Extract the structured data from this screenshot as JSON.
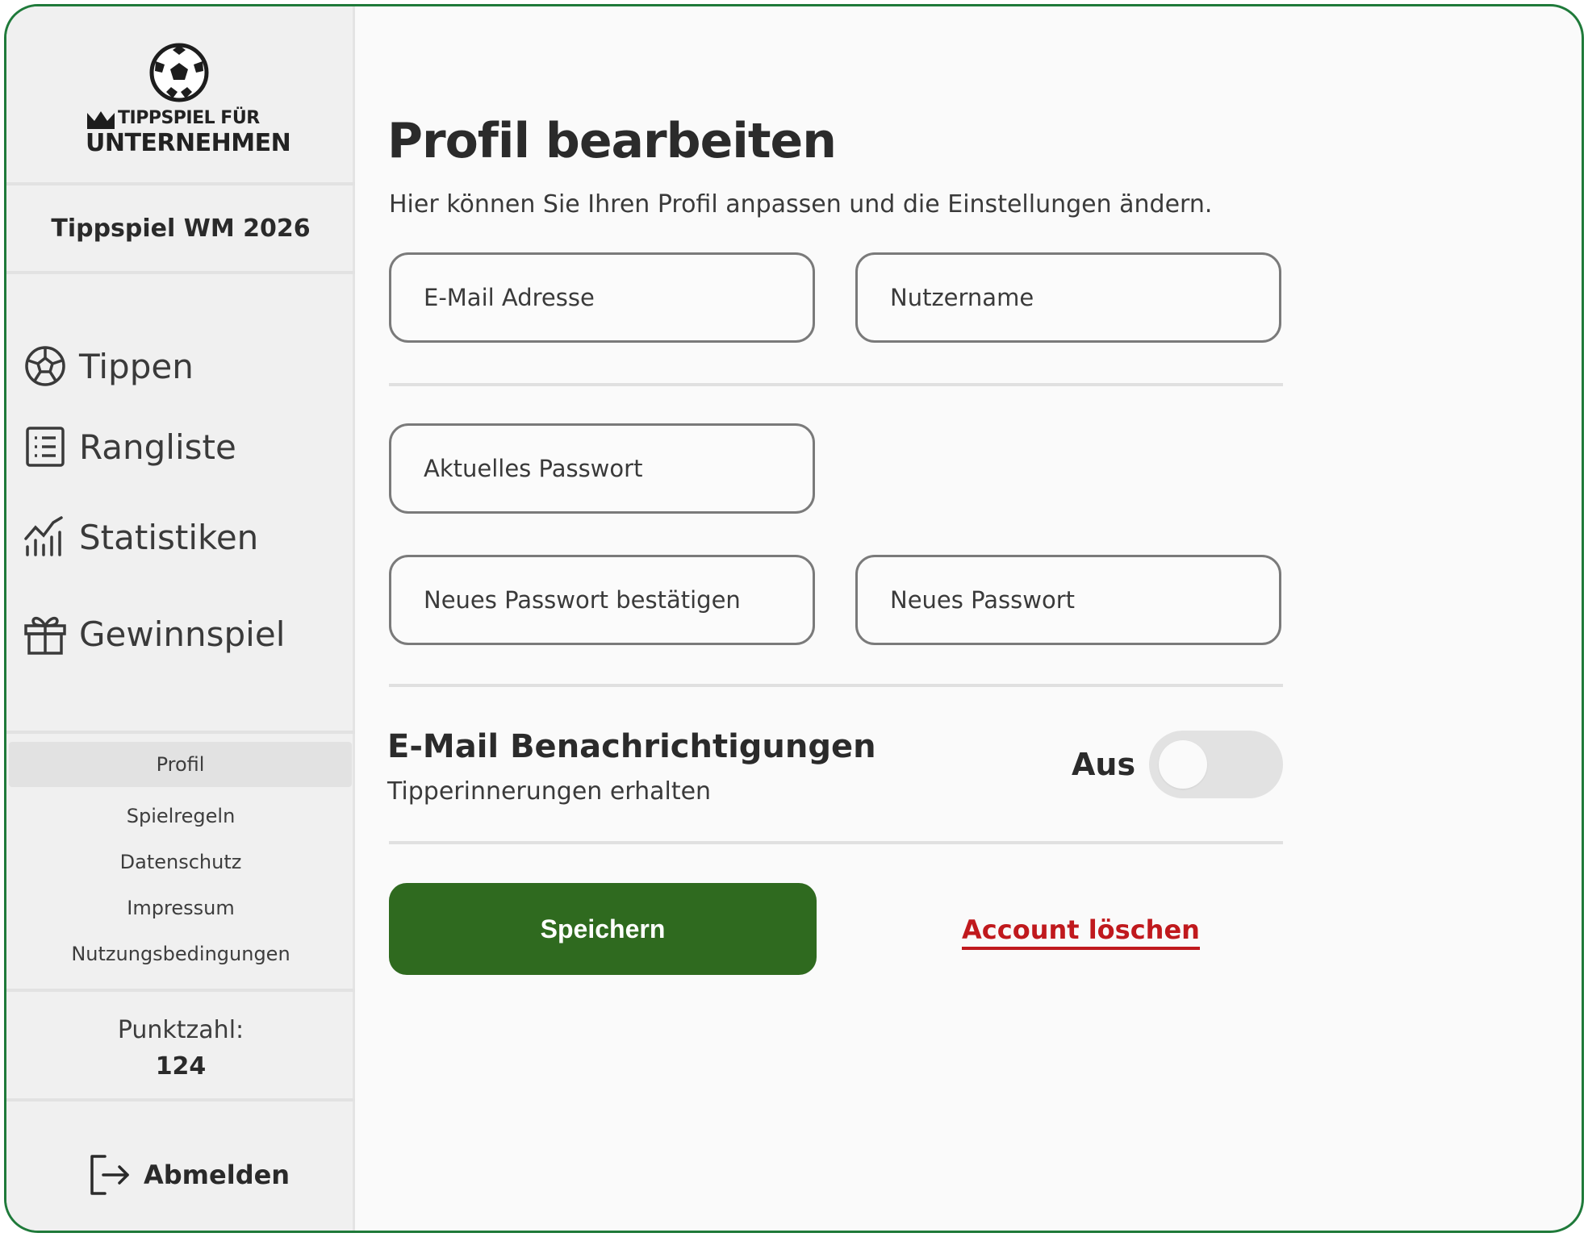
{
  "brand": {
    "logo_line1": "TIPPSPIEL FÜR",
    "logo_line2": "UNTERNEHMEN"
  },
  "sidebar": {
    "game_title": "Tippspiel WM 2026",
    "nav": [
      {
        "label": "Tippen",
        "icon": "soccer-ball-icon"
      },
      {
        "label": "Rangliste",
        "icon": "list-icon"
      },
      {
        "label": "Statistiken",
        "icon": "chart-icon"
      },
      {
        "label": "Gewinnspiel",
        "icon": "gift-icon"
      }
    ],
    "links": [
      {
        "label": "Profil",
        "active": true
      },
      {
        "label": "Spielregeln"
      },
      {
        "label": "Datenschutz"
      },
      {
        "label": "Impressum"
      },
      {
        "label": "Nutzungsbedingungen"
      }
    ],
    "score_label": "Punktzahl:",
    "score_value": "124",
    "logout_label": "Abmelden",
    "logout_icon": "logout-icon"
  },
  "main": {
    "title": "Profil bearbeiten",
    "subtitle": "Hier können Sie Ihren Profil anpassen und die Einstellungen ändern.",
    "fields": {
      "email": "E-Mail Adresse",
      "username": "Nutzername",
      "current_password": "Aktuelles Passwort",
      "confirm_password": "Neues Passwort bestätigen",
      "new_password": "Neues Passwort"
    },
    "notifications": {
      "title": "E-Mail Benachrichtigungen",
      "subtitle": "Tipperinnerungen erhalten",
      "toggle_label": "Aus",
      "enabled": false
    },
    "save_label": "Speichern",
    "delete_label": "Account löschen"
  },
  "colors": {
    "frame_border": "#1f7a3a",
    "primary_button": "#2f6a1f",
    "danger": "#c0191d",
    "sidebar_bg": "#f0f0f0"
  }
}
